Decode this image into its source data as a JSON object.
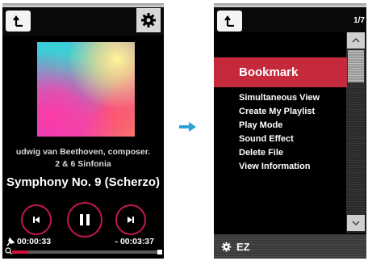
{
  "left_player": {
    "artist": "udwig van Beethoven, composer.",
    "album": "2 & 6 Sinfonia",
    "track_title": "Symphony No. 9 (Scherzo)",
    "elapsed": "00:00:33",
    "remaining": "- 00:03:37",
    "progress_fraction": 0.11,
    "icons": {
      "back": "back-icon",
      "settings": "gear-icon",
      "prev": "previous-track-icon",
      "play_pause": "pause-icon",
      "next": "next-track-icon",
      "pin": "pin-icon",
      "search": "search-icon"
    }
  },
  "transition": {
    "icon": "right-arrow-icon",
    "color": "#2a9fd8"
  },
  "right_menu": {
    "page_indicator": "1/7",
    "highlighted": "Bookmark",
    "items": [
      "Simultaneous View",
      "Create My Playlist",
      "Play Mode",
      "Sound Effect",
      "Delete File",
      "View Information"
    ],
    "bottom_bar_label": "EZ",
    "accent_color": "#c42a3c"
  }
}
